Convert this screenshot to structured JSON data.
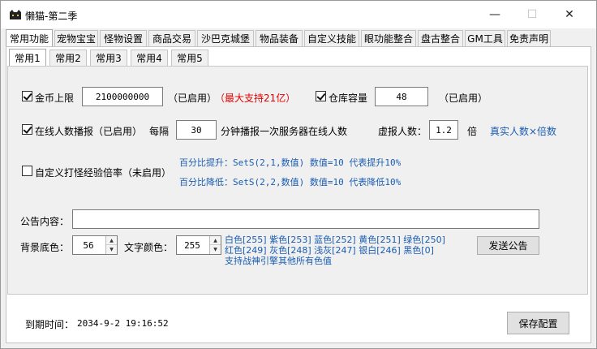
{
  "window": {
    "title": "懒猫-第二季",
    "minimize_glyph": "—",
    "maximize_glyph": "☐",
    "close_glyph": "✕"
  },
  "main_tabs": [
    {
      "label": "常用功能",
      "active": true
    },
    {
      "label": "宠物宝宝",
      "active": false
    },
    {
      "label": "怪物设置",
      "active": false
    },
    {
      "label": "商品交易",
      "active": false
    },
    {
      "label": "沙巴克城堡",
      "active": false
    },
    {
      "label": "物品装备",
      "active": false
    },
    {
      "label": "自定义技能",
      "active": false
    },
    {
      "label": "眼功能整合",
      "active": false
    },
    {
      "label": "盘古整合",
      "active": false
    },
    {
      "label": "GM工具",
      "active": false
    },
    {
      "label": "免责声明",
      "active": false
    }
  ],
  "sub_tabs": [
    {
      "label": "常用1",
      "active": true
    },
    {
      "label": "常用2",
      "active": false
    },
    {
      "label": "常用3",
      "active": false
    },
    {
      "label": "常用4",
      "active": false
    },
    {
      "label": "常用5",
      "active": false
    }
  ],
  "gold": {
    "checked": true,
    "label": "金币上限",
    "value": "2100000000",
    "status": "（已启用）",
    "note": "（最大支持21亿）"
  },
  "warehouse": {
    "checked": true,
    "label": "仓库容量",
    "value": "48",
    "status": "（已启用）"
  },
  "online": {
    "checked": true,
    "label": "在线人数播报（已启用）",
    "every_label": "每隔",
    "minutes": "30",
    "suffix": "分钟播报一次服务器在线人数",
    "virtual_label": "虚报人数：",
    "multiplier": "1.2",
    "times_label": "倍",
    "formula": "真实人数×倍数"
  },
  "exp_rate": {
    "checked": false,
    "label": "自定义打怪经验倍率（未启用）",
    "hint_up": "百分比提升：SetS(2,1,数值)  数值=10 代表提升10%",
    "hint_down": "百分比降低：SetS(2,2,数值)  数值=10 代表降低10%"
  },
  "announce": {
    "label": "公告内容：",
    "value": "",
    "bg_label": "背景底色：",
    "bg_value": "56",
    "text_color_label": "文字颜色：",
    "text_color_value": "255",
    "color_line1": "白色[255] 紫色[253] 蓝色[252] 黄色[251] 绿色[250]",
    "color_line2": "红色[249] 灰色[248] 浅灰[247] 银白[246] 黑色[0]",
    "color_line3": "支持战神引擎其他所有色值",
    "send_label": "发送公告"
  },
  "footer": {
    "expire_label": "到期时间：",
    "expire_value": "2034-9-2 19:16:52",
    "save_label": "保存配置"
  },
  "colors": {
    "red_note": "#e00000",
    "blue_hint": "#1a5db0"
  }
}
